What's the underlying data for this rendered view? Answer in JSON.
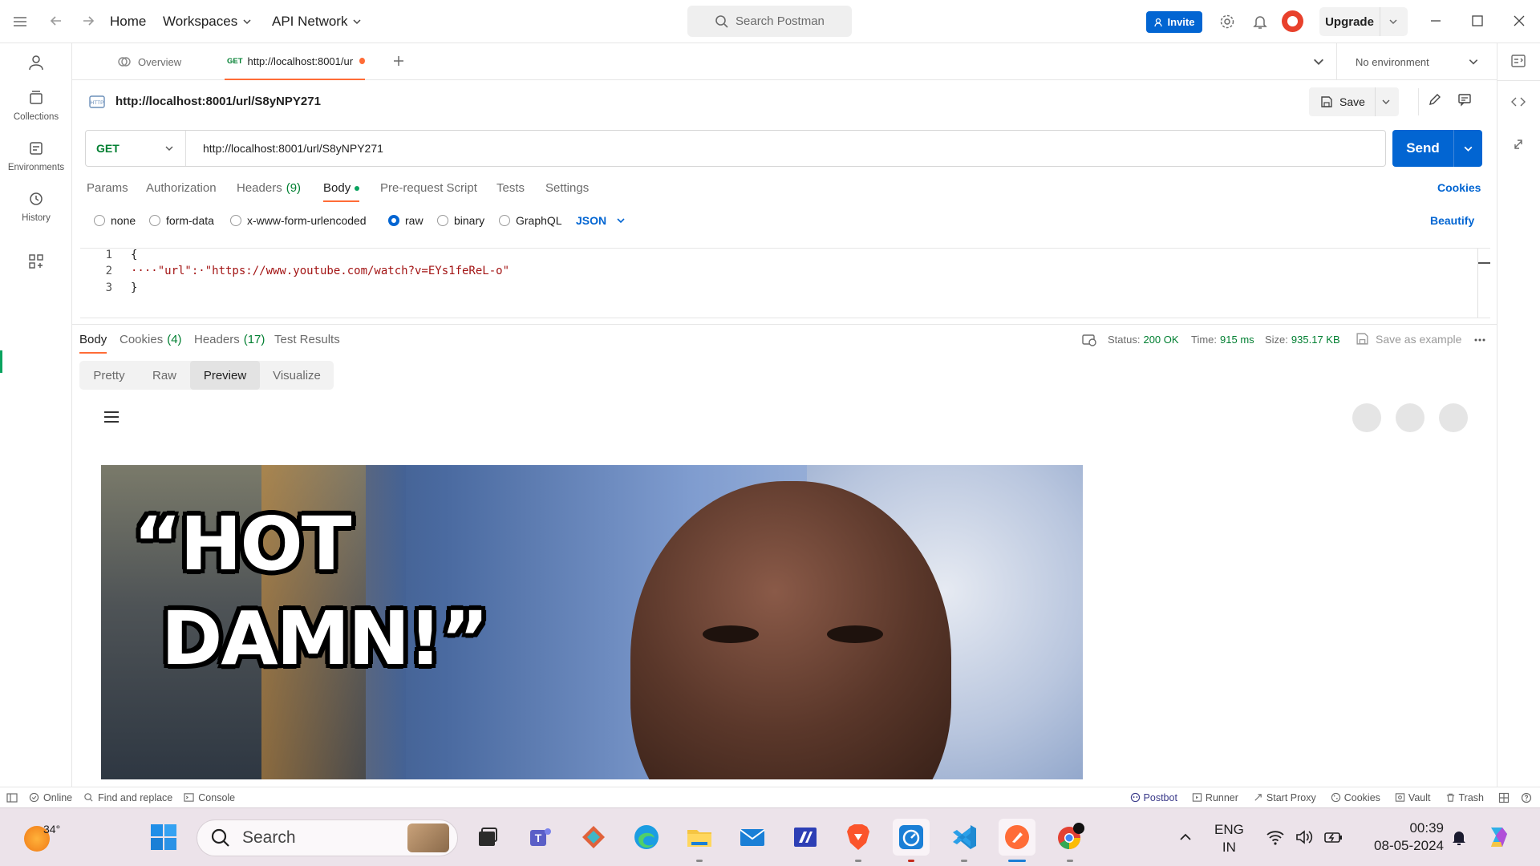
{
  "topbar": {
    "home": "Home",
    "workspaces": "Workspaces",
    "api_network": "API Network",
    "search_placeholder": "Search Postman",
    "invite": "Invite",
    "upgrade": "Upgrade"
  },
  "sidebar": {
    "items": [
      {
        "label": "Collections",
        "icon": "collections-icon"
      },
      {
        "label": "Environments",
        "icon": "environments-icon"
      },
      {
        "label": "History",
        "icon": "history-icon"
      }
    ]
  },
  "tabs": {
    "overview": "Overview",
    "active_method": "GET",
    "active_label": "http://localhost:8001/ur",
    "environment": "No environment"
  },
  "request": {
    "title": "http://localhost:8001/url/S8yNPY271",
    "save": "Save",
    "method": "GET",
    "url": "http://localhost:8001/url/S8yNPY271",
    "send": "Send",
    "subtabs": [
      "Params",
      "Authorization",
      "Headers",
      "Body",
      "Pre-request Script",
      "Tests",
      "Settings"
    ],
    "headers_count": "(9)",
    "cookies": "Cookies",
    "body_types": [
      "none",
      "form-data",
      "x-www-form-urlencoded",
      "raw",
      "binary",
      "GraphQL"
    ],
    "selected_body_type": "raw",
    "format": "JSON",
    "beautify": "Beautify",
    "code_lines": [
      "{",
      "····\"url\":·\"https://www.youtube.com/watch?v=EYs1feReL-o\"",
      "}"
    ],
    "line_numbers": [
      "1",
      "2",
      "3"
    ]
  },
  "response": {
    "tabs": {
      "body": "Body",
      "cookies": "Cookies",
      "cookies_count": "(4)",
      "headers": "Headers",
      "headers_count": "(17)",
      "test_results": "Test Results"
    },
    "status_label": "Status:",
    "status_value": "200 OK",
    "time_label": "Time:",
    "time_value": "915 ms",
    "size_label": "Size:",
    "size_value": "935.17 KB",
    "save_example": "Save as example",
    "views": [
      "Pretty",
      "Raw",
      "Preview",
      "Visualize"
    ],
    "selected_view": "Preview",
    "preview_caption_line1": "“HOT",
    "preview_caption_line2": "DAMN!”"
  },
  "statusbar": {
    "online": "Online",
    "find_replace": "Find and replace",
    "console": "Console",
    "postbot": "Postbot",
    "runner": "Runner",
    "start_proxy": "Start Proxy",
    "cookies": "Cookies",
    "vault": "Vault",
    "trash": "Trash"
  },
  "taskbar": {
    "weather": "34°",
    "search": "Search",
    "lang_line1": "ENG",
    "lang_line2": "IN",
    "time": "00:39",
    "date": "08-05-2024"
  },
  "colors": {
    "accent": "#0265d2",
    "active_tab": "#ff6c37",
    "success": "#007f31"
  }
}
